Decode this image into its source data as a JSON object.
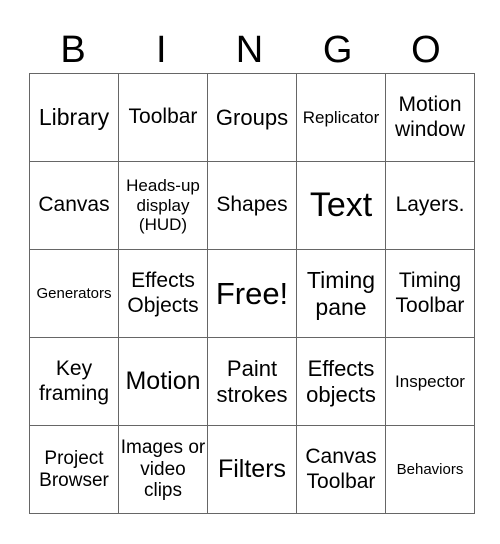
{
  "header": [
    "B",
    "I",
    "N",
    "G",
    "O"
  ],
  "cells": [
    [
      "Library",
      "Toolbar",
      "Groups",
      "Replicator",
      "Motion window"
    ],
    [
      "Canvas",
      "Heads-up display (HUD)",
      "Shapes",
      "Text",
      "Layers."
    ],
    [
      "Generators",
      "Effects Objects",
      "Free!",
      "Timing pane",
      "Timing Toolbar"
    ],
    [
      "Key framing",
      "Motion",
      "Paint strokes",
      "Effects objects",
      "Inspector"
    ],
    [
      "Project Browser",
      "Images or video clips",
      "Filters",
      "Canvas Toolbar",
      "Behaviors"
    ]
  ]
}
